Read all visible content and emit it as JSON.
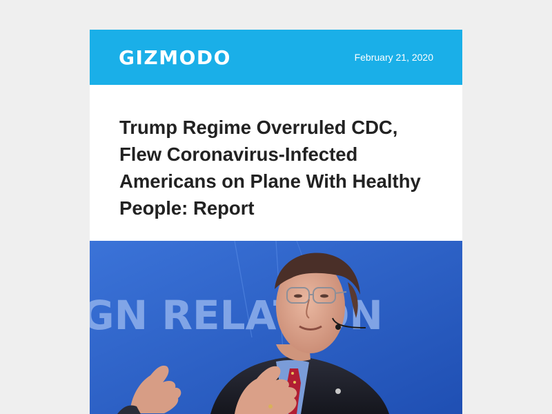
{
  "email": {
    "brand": "GIZMODO",
    "date": "February 21, 2020",
    "colors": {
      "header_bg": "#1aafe8",
      "page_bg": "#efefef",
      "headline": "#222222"
    }
  },
  "article": {
    "headline": "Trump Regime Overruled CDC, Flew Coronavirus-Infected Americans on Plane With Healthy People: Report",
    "hero_banner_text": "GN RELATION"
  }
}
